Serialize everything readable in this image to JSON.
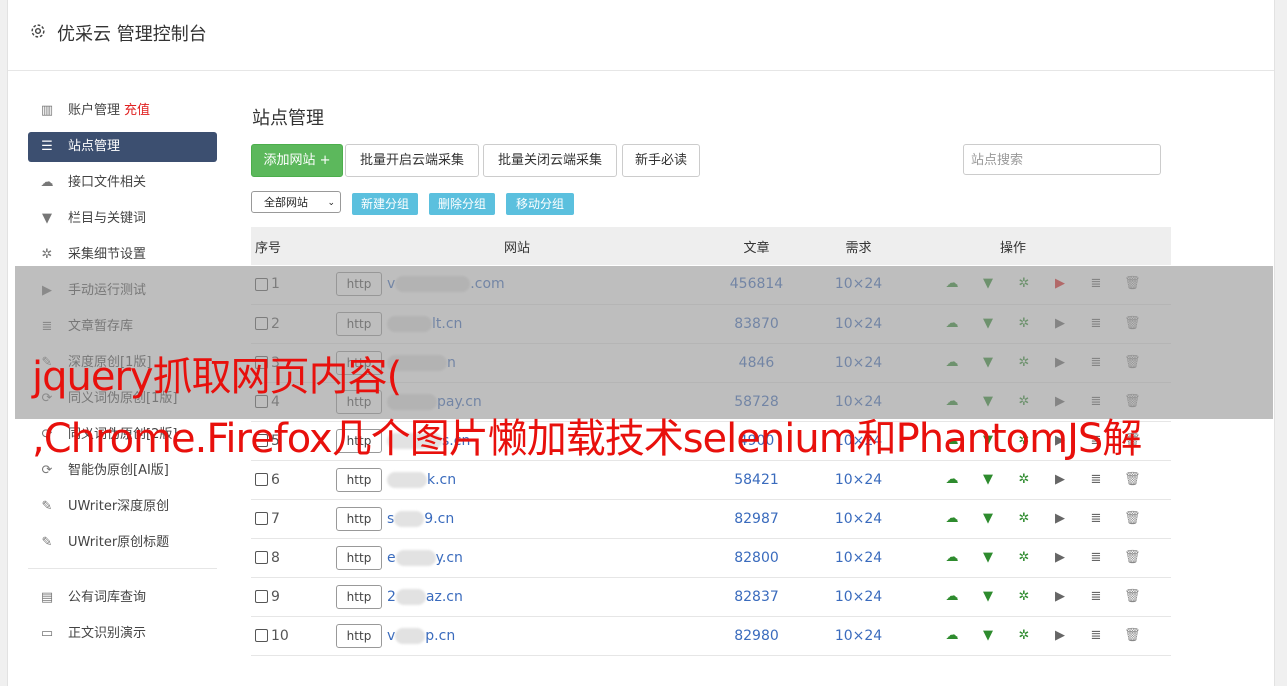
{
  "header": {
    "title": "优采云 管理控制台",
    "icon": "gear-icon"
  },
  "sidebar": {
    "items": [
      {
        "label": "账户管理",
        "extra": "充值",
        "icon": "bar-chart-icon"
      },
      {
        "label": "站点管理",
        "icon": "server-icon",
        "active": true
      },
      {
        "label": "接口文件相关",
        "icon": "cloud-icon"
      },
      {
        "label": "栏目与关键词",
        "icon": "filter-icon"
      },
      {
        "label": "采集细节设置",
        "icon": "gears-icon"
      },
      {
        "label": "手动运行测试",
        "icon": "play-icon"
      },
      {
        "label": "文章暂存库",
        "icon": "database-icon"
      },
      {
        "label": "深度原创[1版]",
        "icon": "edit-icon"
      },
      {
        "label": "同义词伪原创[1版]",
        "icon": "refresh-icon"
      },
      {
        "label": "同义词伪原创[2版]",
        "icon": "refresh-icon"
      },
      {
        "label": "智能伪原创[AI版]",
        "icon": "refresh-icon"
      },
      {
        "label": "UWriter深度原创",
        "icon": "edit-icon"
      },
      {
        "label": "UWriter原创标题",
        "icon": "edit-icon"
      }
    ],
    "items2": [
      {
        "label": "公有词库查询",
        "icon": "book-icon"
      },
      {
        "label": "正文识别演示",
        "icon": "monitor-icon"
      }
    ]
  },
  "main": {
    "title": "站点管理",
    "buttons": {
      "add": "添加网站 +",
      "batch_on": "批量开启云端采集",
      "batch_off": "批量关闭云端采集",
      "guide": "新手必读"
    },
    "search_placeholder": "站点搜索",
    "group_select": "全部网站",
    "group_buttons": {
      "new": "新建分组",
      "delete": "删除分组",
      "move": "移动分组"
    },
    "columns": {
      "seq": "序号",
      "site": "网站",
      "articles": "文章",
      "demand": "需求",
      "ops": "操作"
    },
    "rows": [
      {
        "seq": "1",
        "proto": "http",
        "site_pre": "v",
        "site_suf": ".com",
        "articles": "456814",
        "demand": "10×24"
      },
      {
        "seq": "2",
        "proto": "http",
        "site_pre": "",
        "site_suf": "lt.cn",
        "articles": "83870",
        "demand": "10×24"
      },
      {
        "seq": "3",
        "proto": "http",
        "site_pre": "",
        "site_suf": "n",
        "articles": "4846",
        "demand": "10×24"
      },
      {
        "seq": "4",
        "proto": "http",
        "site_pre": "",
        "site_suf": "pay.cn",
        "articles": "58728",
        "demand": "10×24"
      },
      {
        "seq": "5",
        "proto": "http",
        "site_pre": "",
        "site_suf": "s.cn",
        "articles": "4900",
        "demand": "10×24"
      },
      {
        "seq": "6",
        "proto": "http",
        "site_pre": "",
        "site_suf": "k.cn",
        "articles": "58421",
        "demand": "10×24"
      },
      {
        "seq": "7",
        "proto": "http",
        "site_pre": "s",
        "site_suf": "9.cn",
        "articles": "82987",
        "demand": "10×24"
      },
      {
        "seq": "8",
        "proto": "http",
        "site_pre": "e",
        "site_suf": "y.cn",
        "articles": "82800",
        "demand": "10×24"
      },
      {
        "seq": "9",
        "proto": "http",
        "site_pre": "2",
        "site_suf": "az.cn",
        "articles": "82837",
        "demand": "10×24"
      },
      {
        "seq": "10",
        "proto": "http",
        "site_pre": "v",
        "site_suf": "p.cn",
        "articles": "82980",
        "demand": "10×24"
      }
    ],
    "op_icons": [
      "cloud-upload-icon",
      "filter-icon",
      "gears-icon",
      "play-icon",
      "database-icon",
      "trash-icon"
    ]
  },
  "overlay": {
    "line1": "jquery抓取网页内容(",
    "line2": ",Chrome.Firefox几个图片懒加载技术selenium和PhantomJS解"
  },
  "colors": {
    "accent": "#3c4f70",
    "green": "#5cb85c",
    "info": "#5bc0de",
    "link": "#3a6bbd",
    "overlay_text": "#e8100c"
  }
}
